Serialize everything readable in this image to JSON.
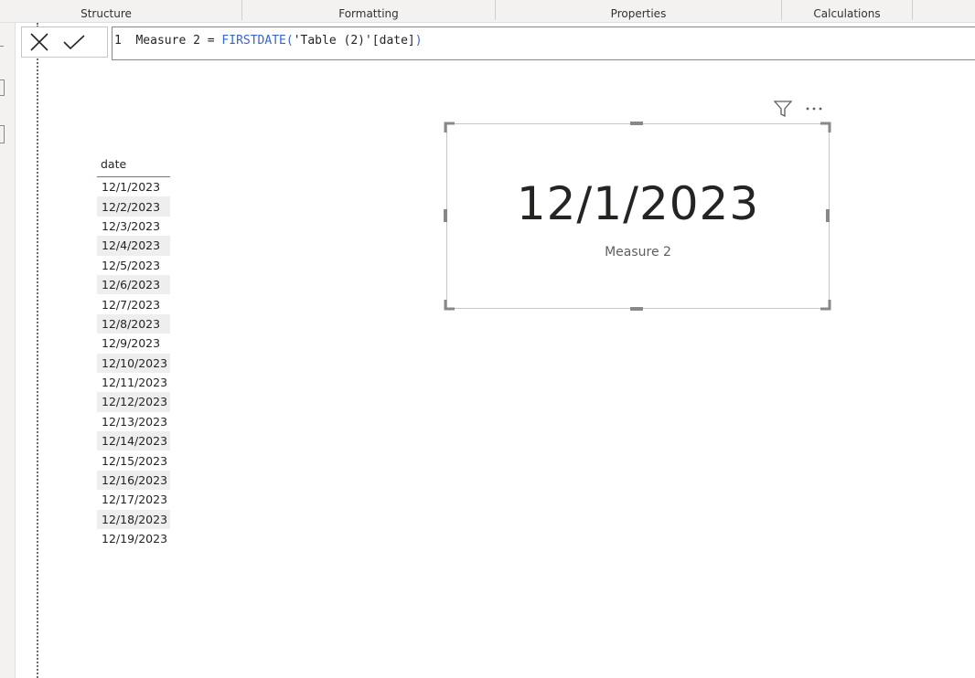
{
  "ribbon": {
    "groups": [
      "Structure",
      "Formatting",
      "Properties",
      "Calculations"
    ]
  },
  "formula_bar": {
    "line_number": "1",
    "measure_name": "Measure 2",
    "operator": "=",
    "function": "FIRSTDATE",
    "open_paren": "(",
    "table_ref": "'Table (2)'",
    "column_ref": "[date]",
    "close_paren": ")"
  },
  "table": {
    "header": "date",
    "rows": [
      "12/1/2023",
      "12/2/2023",
      "12/3/2023",
      "12/4/2023",
      "12/5/2023",
      "12/6/2023",
      "12/7/2023",
      "12/8/2023",
      "12/9/2023",
      "12/10/2023",
      "12/11/2023",
      "12/12/2023",
      "12/13/2023",
      "12/14/2023",
      "12/15/2023",
      "12/16/2023",
      "12/17/2023",
      "12/18/2023",
      "12/19/2023"
    ]
  },
  "card": {
    "value": "12/1/2023",
    "label": "Measure 2"
  },
  "icons": {
    "cancel": "close-icon",
    "commit": "checkmark-icon",
    "filter": "filter-icon",
    "more": "more-options-icon"
  },
  "colors": {
    "accent": "#118dff",
    "function_blue": "#3566c8",
    "row_alt": "#eeeeee"
  }
}
